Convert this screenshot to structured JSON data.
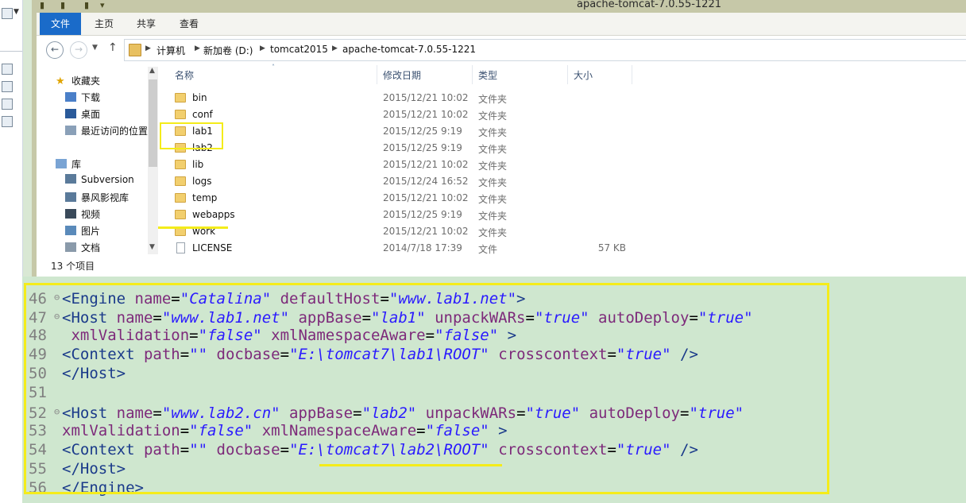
{
  "window": {
    "title": "apache-tomcat-7.0.55-1221"
  },
  "ribbon": {
    "tabs": [
      "文件",
      "主页",
      "共享",
      "查看"
    ]
  },
  "address": {
    "crumbs": [
      "计算机",
      "新加卷 (D:)",
      "tomcat2015",
      "apache-tomcat-7.0.55-1221"
    ]
  },
  "nav_pane": {
    "items": [
      {
        "label": "收藏夹",
        "icon": "star-icon"
      },
      {
        "label": "下载",
        "icon": "download-folder-icon"
      },
      {
        "label": "桌面",
        "icon": "desktop-icon"
      },
      {
        "label": "最近访问的位置",
        "icon": "recent-places-icon"
      },
      {
        "label": "库",
        "icon": "library-icon"
      },
      {
        "label": "Subversion",
        "icon": "library-folder-icon"
      },
      {
        "label": "暴风影视库",
        "icon": "library-folder-icon"
      },
      {
        "label": "视频",
        "icon": "video-library-icon"
      },
      {
        "label": "图片",
        "icon": "pictures-library-icon"
      },
      {
        "label": "文档",
        "icon": "documents-library-icon"
      }
    ]
  },
  "file_list": {
    "columns": [
      "名称",
      "修改日期",
      "类型",
      "大小"
    ],
    "rows": [
      {
        "name": "bin",
        "date": "2015/12/21 10:02",
        "type": "文件夹",
        "size": "",
        "kind": "folder"
      },
      {
        "name": "conf",
        "date": "2015/12/21 10:02",
        "type": "文件夹",
        "size": "",
        "kind": "folder"
      },
      {
        "name": "lab1",
        "date": "2015/12/25 9:19",
        "type": "文件夹",
        "size": "",
        "kind": "folder"
      },
      {
        "name": "lab2",
        "date": "2015/12/25 9:19",
        "type": "文件夹",
        "size": "",
        "kind": "folder"
      },
      {
        "name": "lib",
        "date": "2015/12/21 10:02",
        "type": "文件夹",
        "size": "",
        "kind": "folder"
      },
      {
        "name": "logs",
        "date": "2015/12/24 16:52",
        "type": "文件夹",
        "size": "",
        "kind": "folder"
      },
      {
        "name": "temp",
        "date": "2015/12/21 10:02",
        "type": "文件夹",
        "size": "",
        "kind": "folder"
      },
      {
        "name": "webapps",
        "date": "2015/12/25 9:19",
        "type": "文件夹",
        "size": "",
        "kind": "folder"
      },
      {
        "name": "work",
        "date": "2015/12/21 10:02",
        "type": "文件夹",
        "size": "",
        "kind": "folder"
      },
      {
        "name": "LICENSE",
        "date": "2014/7/18 17:39",
        "type": "文件",
        "size": "57 KB",
        "kind": "file"
      }
    ]
  },
  "status": {
    "item_count": "13 个项目"
  },
  "code": {
    "lines": [
      {
        "num": "46",
        "fold": "⊖",
        "text": "<Engine name=\"Catalina\" defaultHost=\"www.lab1.net\">"
      },
      {
        "num": "47",
        "fold": "⊖",
        "text": "<Host name=\"www.lab1.net\" appBase=\"lab1\" unpackWARs=\"true\" autoDeploy=\"true\""
      },
      {
        "num": "48",
        "fold": "",
        "text": " xmlValidation=\"false\" xmlNamespaceAware=\"false\" >"
      },
      {
        "num": "49",
        "fold": "",
        "text": "<Context path=\"\" docbase=\"E:\\tomcat7\\lab1\\ROOT\" crosscontext=\"true\" />"
      },
      {
        "num": "50",
        "fold": "",
        "text": "</Host>"
      },
      {
        "num": "51",
        "fold": "",
        "text": ""
      },
      {
        "num": "52",
        "fold": "⊖",
        "text": "<Host name=\"www.lab2.cn\" appBase=\"lab2\" unpackWARs=\"true\" autoDeploy=\"true\""
      },
      {
        "num": "53",
        "fold": "",
        "text": "xmlValidation=\"false\" xmlNamespaceAware=\"false\" >"
      },
      {
        "num": "54",
        "fold": "",
        "text": "<Context path=\"\" docbase=\"E:\\tomcat7\\lab2\\ROOT\" crosscontext=\"true\" />"
      },
      {
        "num": "55",
        "fold": "",
        "text": "</Host>"
      },
      {
        "num": "56",
        "fold": "",
        "text": "</Engine>"
      }
    ]
  },
  "colors": {
    "highlight": "#f4ec1a",
    "editor_bg": "#cfe7cf",
    "file_tab": "#1a6bc9",
    "titlebar": "#c6c8a8"
  }
}
